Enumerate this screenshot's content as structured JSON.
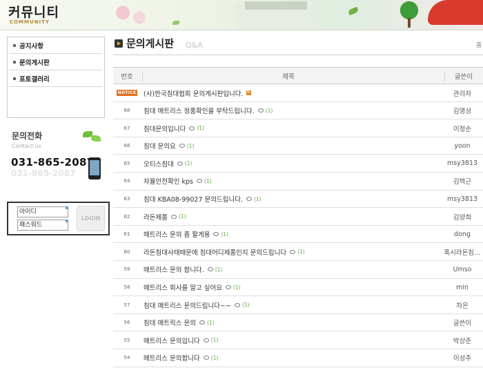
{
  "header": {
    "title": "커뮤니티",
    "subtitle": "COMMUNITY"
  },
  "sidebar": {
    "items": [
      {
        "label": "공지사항"
      },
      {
        "label": "문의게시판"
      },
      {
        "label": "포토갤러리"
      }
    ]
  },
  "contact": {
    "title": "문의전화",
    "subtitle": "Contact us",
    "phone": "031-865-2087"
  },
  "login": {
    "id_placeholder": "아이디",
    "pw_placeholder": "패스워드",
    "button_label": "LOGIN"
  },
  "board": {
    "title": "문의게시판",
    "subtitle": "Q&A",
    "edge_text": "홈",
    "columns": {
      "num": "번호",
      "title": "제목",
      "author": "글쓴이"
    },
    "notice": {
      "badge": "NOTICE",
      "title": "(사)한국침대협회 문의게시판입니다.",
      "author": "관리자",
      "new_badge": "N"
    },
    "rows": [
      {
        "num": "68",
        "title": "침대 매트리스 정품확인을 부탁드립니다.",
        "comments": "(1)",
        "author": "김영성"
      },
      {
        "num": "67",
        "title": "침대문의입니다",
        "comments": "(1)",
        "author": "이정순"
      },
      {
        "num": "66",
        "title": "침대 문의요",
        "comments": "(1)",
        "author": "yoon"
      },
      {
        "num": "65",
        "title": "오티스침대",
        "comments": "(1)",
        "author": "msy3813"
      },
      {
        "num": "64",
        "title": "자율안전확인 kps",
        "comments": "(1)",
        "author": "김택근"
      },
      {
        "num": "63",
        "title": "침대 KBA08-99027 문의드립니다.",
        "comments": "(1)",
        "author": "msy3813"
      },
      {
        "num": "62",
        "title": "라돈제품",
        "comments": "(1)",
        "author": "김양희"
      },
      {
        "num": "61",
        "title": "매트리스 문의 좀 할게용",
        "comments": "(1)",
        "author": "dong"
      },
      {
        "num": "60",
        "title": "라돈침대사태때문에 침대어디제품인지 문의드립니다",
        "comments": "(1)",
        "author": "혹시라돈침…"
      },
      {
        "num": "59",
        "title": "매트리스 문의 합니다.",
        "comments": "(1)",
        "author": "Umso"
      },
      {
        "num": "58",
        "title": "매트리스 회사를 알고 싶어요",
        "comments": "(1)",
        "author": "min"
      },
      {
        "num": "57",
        "title": "침대 매트리스 문의드립니다~~",
        "comments": "(1)",
        "author": "차은"
      },
      {
        "num": "56",
        "title": "침대 매트릭스 문의",
        "comments": "(1)",
        "author": "글쓴이"
      },
      {
        "num": "55",
        "title": "매트리스 문의입니다",
        "comments": "(1)",
        "author": "박상준"
      },
      {
        "num": "54",
        "title": "매트리스 문의합니다",
        "comments": "(1)",
        "author": "이성주"
      }
    ]
  }
}
